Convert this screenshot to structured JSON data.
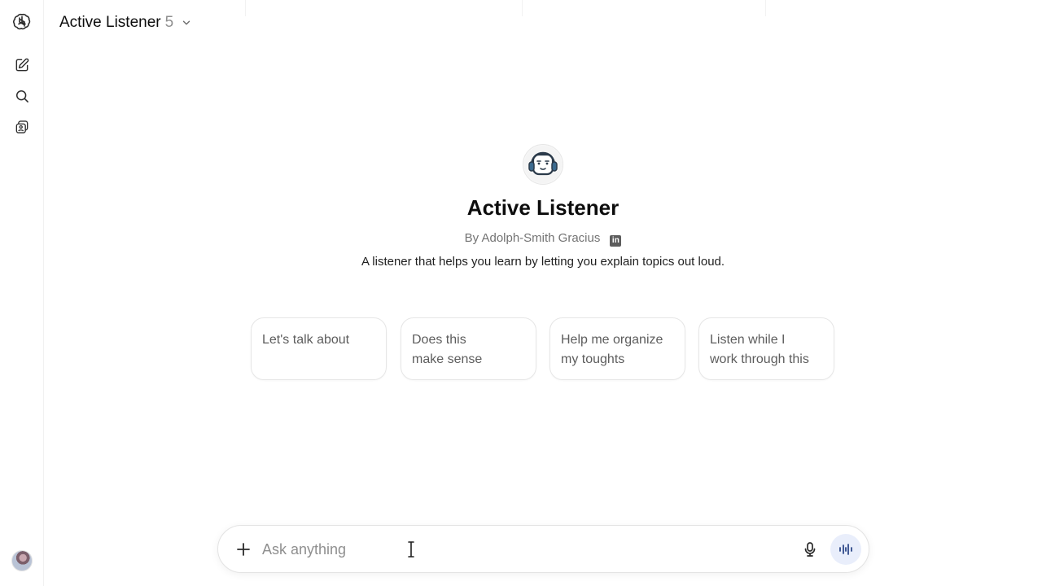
{
  "header": {
    "title": "Active Listener",
    "version": "5"
  },
  "rail": {
    "icons": [
      "logo-icon",
      "new-chat-icon",
      "search-icon",
      "gpts-icon"
    ]
  },
  "gpt": {
    "name": "Active Listener",
    "author": "By Adolph-Smith Gracius",
    "description": "A listener that helps you learn by letting you explain topics out loud."
  },
  "starters": [
    {
      "line1": "Let's talk about",
      "line2": ""
    },
    {
      "line1": "Does this",
      "line2": "make sense"
    },
    {
      "line1": "Help me organize",
      "line2": "my toughts"
    },
    {
      "line1": "Listen while I",
      "line2": "work through this"
    }
  ],
  "composer": {
    "placeholder": "Ask anything",
    "value": ""
  }
}
